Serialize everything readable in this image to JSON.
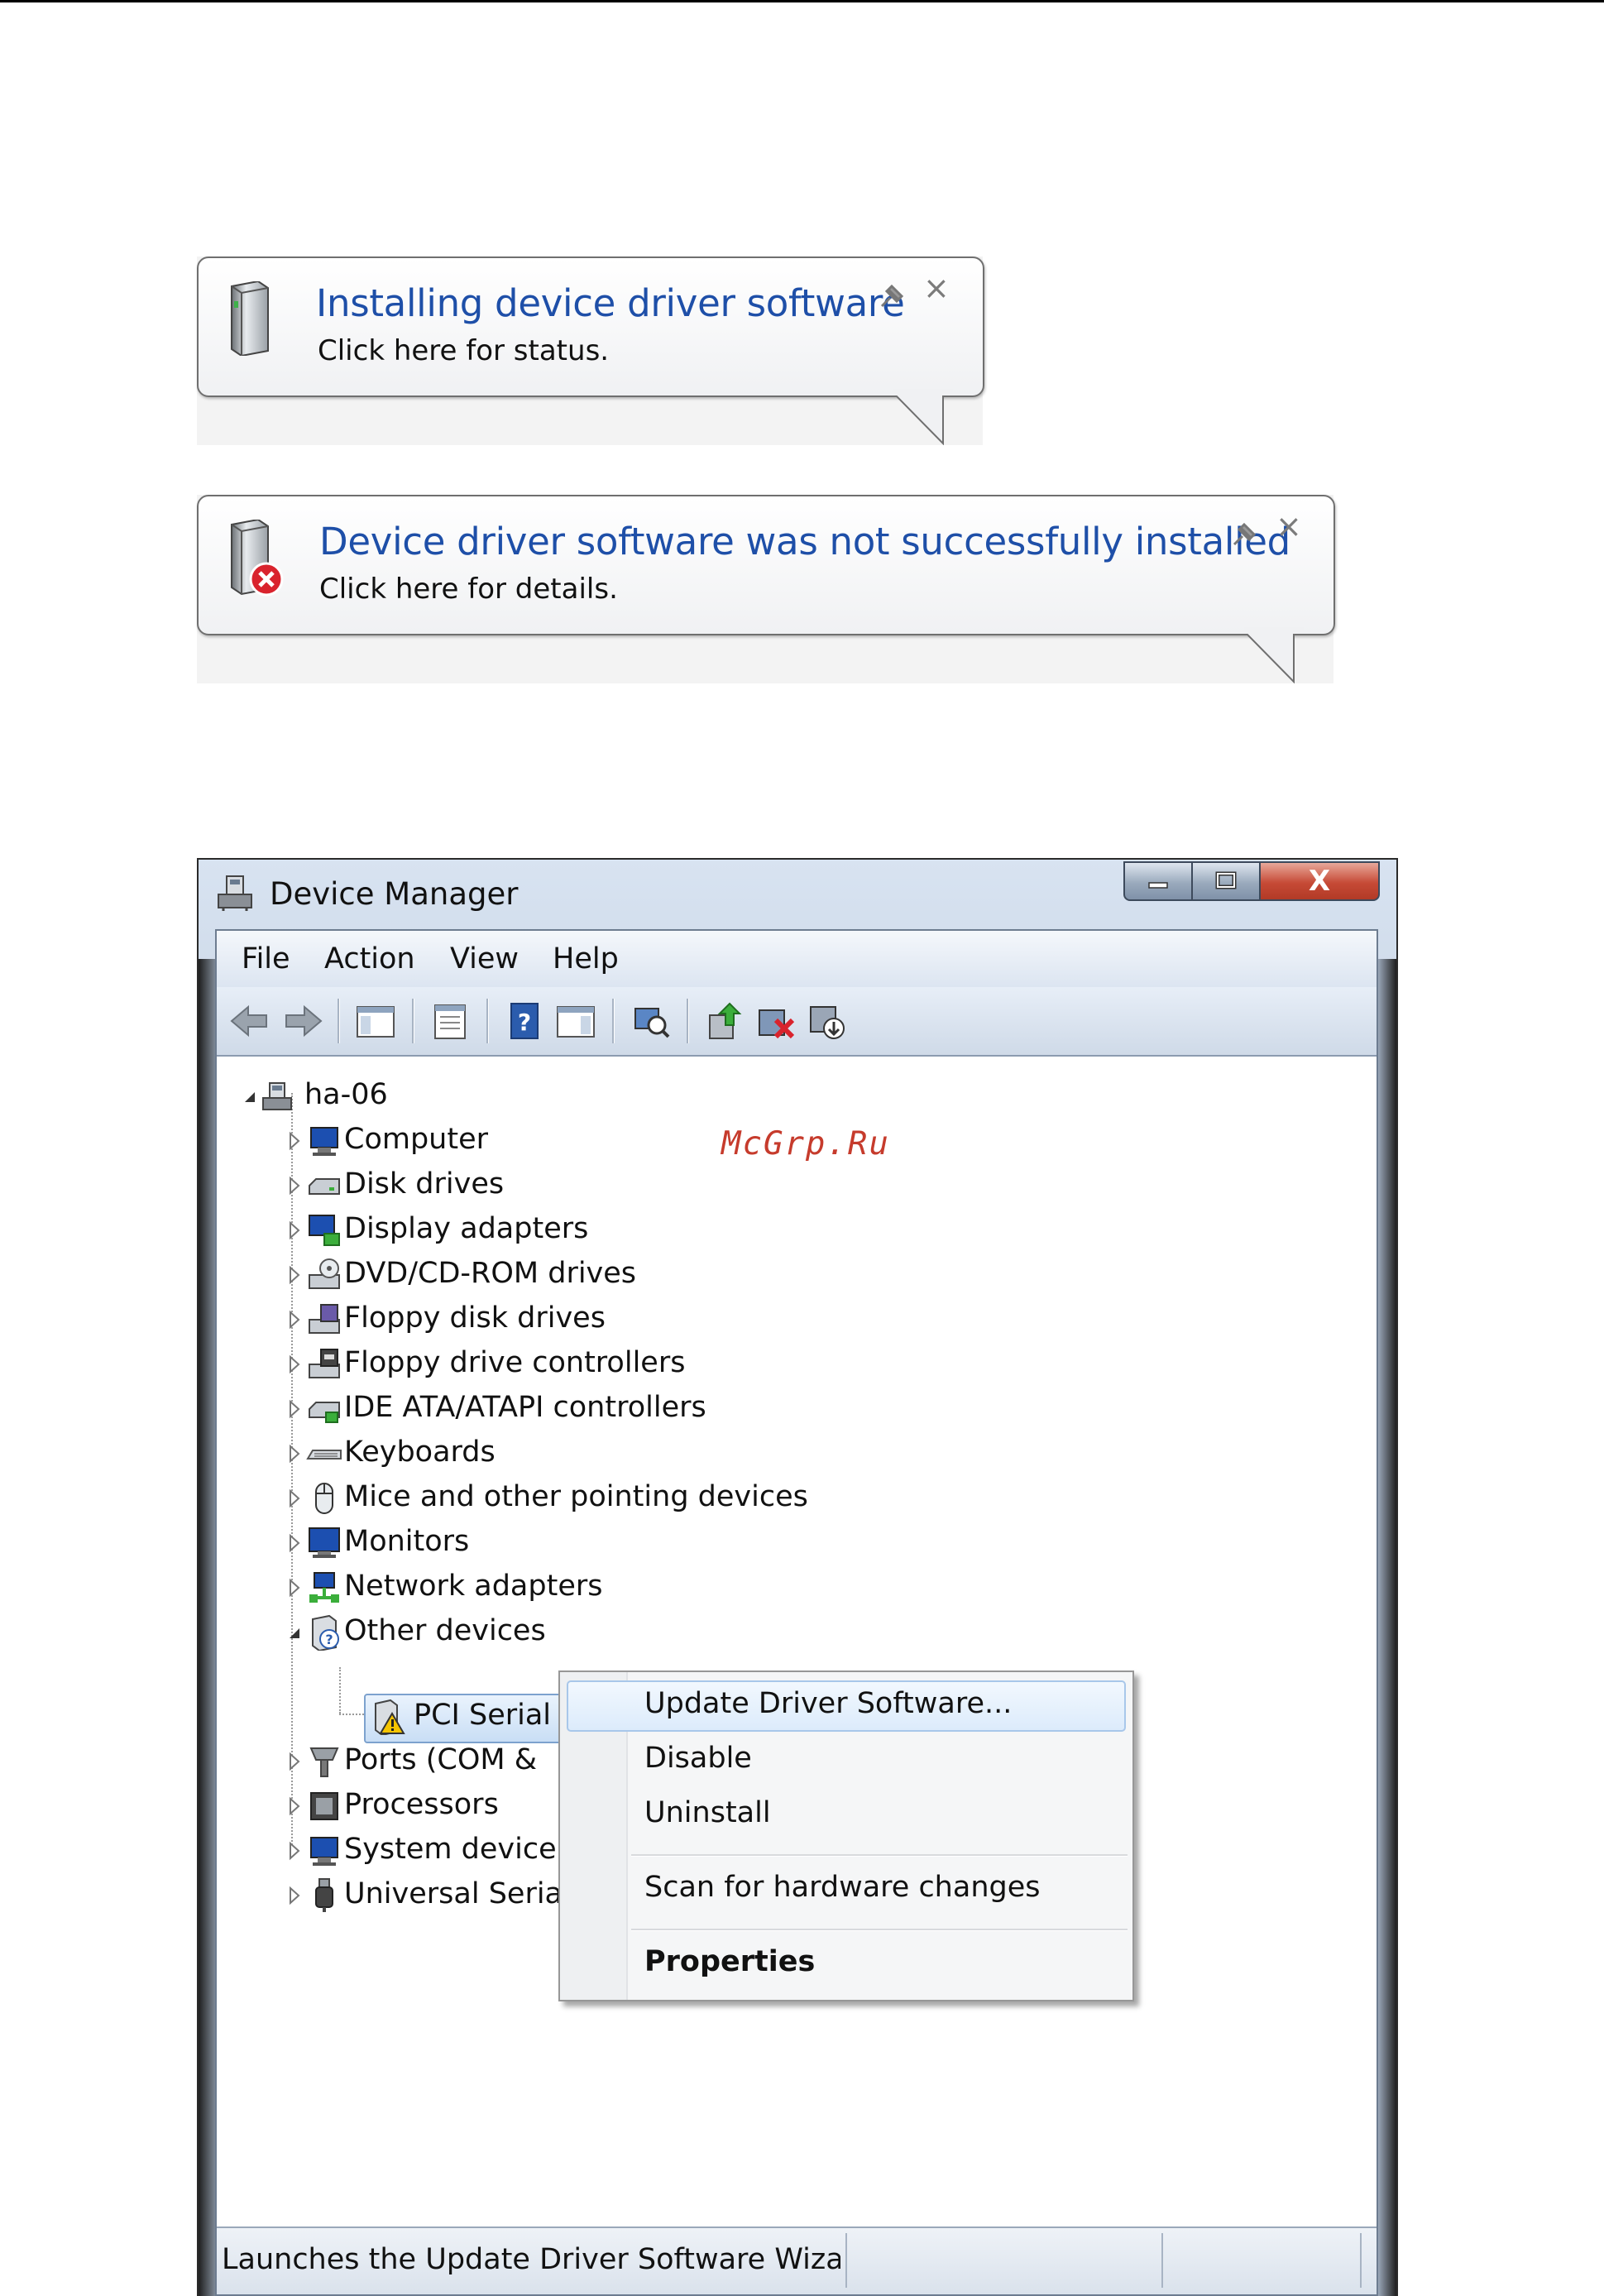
{
  "balloons": [
    {
      "title": "Installing device driver software",
      "subtitle": "Click here for status.",
      "icon": "device-drive-icon",
      "pin_icon": "pin-icon",
      "close_label": "×"
    },
    {
      "title": "Device driver software was not successfully installed",
      "subtitle": "Click here for details.",
      "icon": "device-drive-error-icon",
      "pin_icon": "pin-icon",
      "close_label": "×"
    }
  ],
  "watermark": "McGrp.Ru",
  "window": {
    "title": "Device Manager",
    "close_label": "X",
    "menu": [
      "File",
      "Action",
      "View",
      "Help"
    ],
    "toolbar": [
      "back-icon",
      "forward-icon",
      "show-hide-console-tree-icon",
      "properties-icon",
      "help-icon",
      "action-pane-icon",
      "scan-hardware-icon",
      "update-driver-icon",
      "disable-device-icon",
      "uninstall-device-icon"
    ],
    "tree": {
      "root": "ha-06",
      "items": [
        {
          "label": "Computer",
          "icon": "computer-icon"
        },
        {
          "label": "Disk drives",
          "icon": "disk-drive-icon"
        },
        {
          "label": "Display adapters",
          "icon": "display-adapter-icon"
        },
        {
          "label": "DVD/CD-ROM drives",
          "icon": "dvd-drive-icon"
        },
        {
          "label": "Floppy disk drives",
          "icon": "floppy-drive-icon"
        },
        {
          "label": "Floppy drive controllers",
          "icon": "floppy-controller-icon"
        },
        {
          "label": "IDE ATA/ATAPI controllers",
          "icon": "ide-controller-icon"
        },
        {
          "label": "Keyboards",
          "icon": "keyboard-icon"
        },
        {
          "label": "Mice and other pointing devices",
          "icon": "mouse-icon"
        },
        {
          "label": "Monitors",
          "icon": "monitor-icon"
        },
        {
          "label": "Network adapters",
          "icon": "network-adapter-icon"
        },
        {
          "label": "Other devices",
          "icon": "unknown-device-icon"
        },
        {
          "label": "PCI Serial Port",
          "icon": "warning-device-icon"
        },
        {
          "label": "Ports (COM &",
          "icon": "port-icon"
        },
        {
          "label": "Processors",
          "icon": "processor-icon"
        },
        {
          "label": "System device",
          "icon": "system-device-icon"
        },
        {
          "label": "Universal Seria",
          "icon": "usb-icon"
        }
      ]
    },
    "status": "Launches the Update Driver Software Wizard fc"
  },
  "context_menu": {
    "items": [
      "Update Driver Software...",
      "Disable",
      "Uninstall",
      "Scan for hardware changes",
      "Properties"
    ],
    "highlighted": "Update Driver Software..."
  },
  "colors": {
    "balloon_title": "#1e4fa8",
    "window_frame": "#9fb0c4",
    "close_button": "#c64a36",
    "watermark": "#c63b2c"
  }
}
